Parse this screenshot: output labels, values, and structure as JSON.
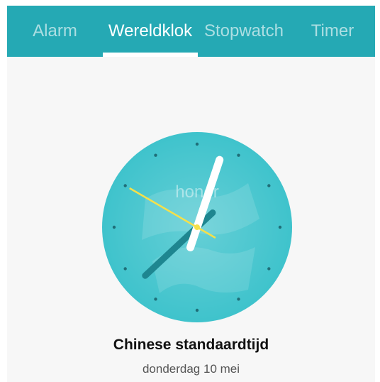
{
  "tabs": {
    "alarm": "Alarm",
    "worldclock": "Wereldklok",
    "stopwatch": "Stopwatch",
    "timer": "Timer"
  },
  "clock": {
    "brand": "honor",
    "city": "Chinese standaardtijd",
    "date": "donderdag 10 mei",
    "time": "12:37:50"
  },
  "colors": {
    "accent": "#25a9b4",
    "dial": "#3fc3cc",
    "second_hand": "#f5e04a"
  }
}
